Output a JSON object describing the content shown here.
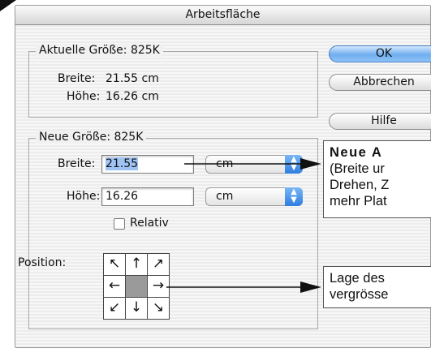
{
  "window": {
    "title": "Arbeitsfläche"
  },
  "current_size": {
    "legend": "Aktuelle Größe: 825K",
    "width_label": "Breite:",
    "width_value": "21.55 cm",
    "height_label": "Höhe:",
    "height_value": "16.26 cm"
  },
  "new_size": {
    "legend": "Neue Größe: 825K",
    "width_label": "Breite:",
    "width_value": "21.55",
    "width_unit": "cm",
    "height_label": "Höhe:",
    "height_value": "16.26",
    "height_unit": "cm",
    "relative_label": "Relativ",
    "relative_checked": false,
    "position_label": "Position:"
  },
  "anchor": {
    "cells": [
      "↖",
      "↑",
      "↗",
      "←",
      "",
      "→",
      "↙",
      "↓",
      "↘"
    ],
    "selected": "center"
  },
  "buttons": {
    "ok": "OK",
    "cancel": "Abbrechen",
    "help": "Hilfe"
  },
  "callouts": {
    "new_size_title": "Neue A",
    "new_size_lines": [
      "(Breite ur",
      "Drehen, Z",
      "mehr Plat"
    ],
    "position_lines": [
      "Lage des",
      "vergrösse"
    ]
  },
  "colors": {
    "default_button": "#6faeee",
    "selection": "#9fc3f3",
    "stepper": "#2f7de0"
  }
}
